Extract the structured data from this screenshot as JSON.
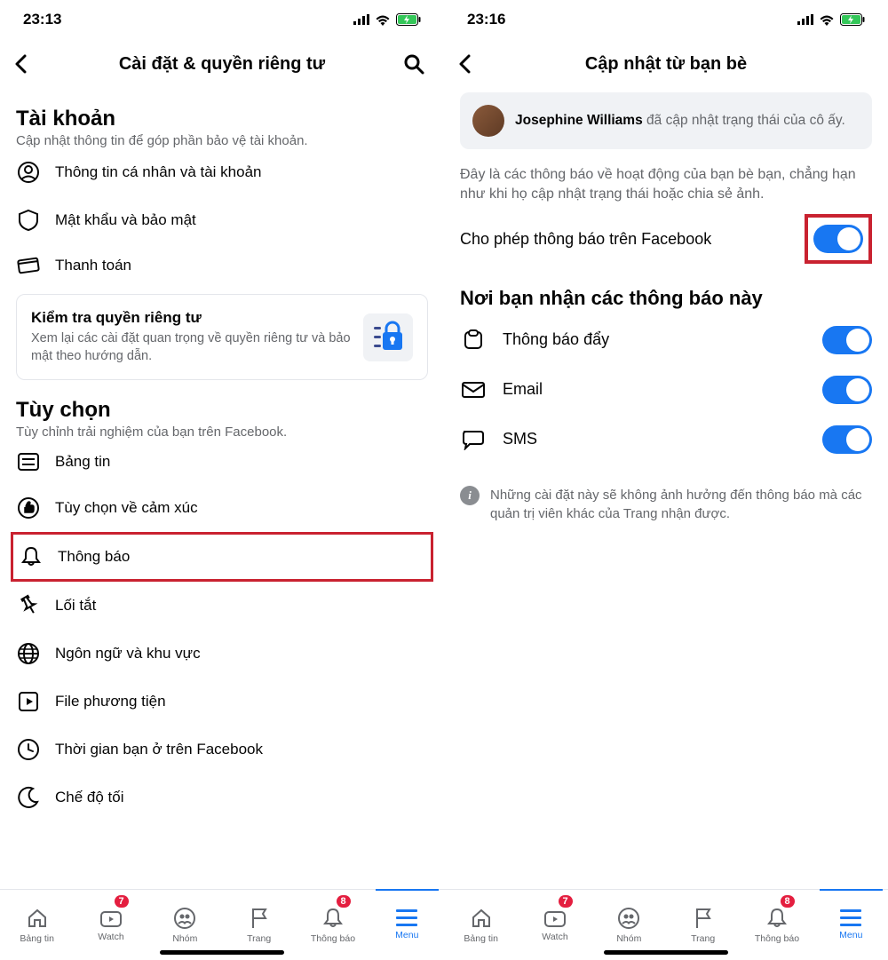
{
  "leftScreen": {
    "statusTime": "23:13",
    "header": {
      "title": "Cài đặt & quyền riêng tư"
    },
    "account": {
      "title": "Tài khoản",
      "subtitle": "Cập nhật thông tin để góp phần bảo vệ tài khoản.",
      "items": [
        "Thông tin cá nhân và tài khoản",
        "Mật khẩu và bảo mật",
        "Thanh toán"
      ],
      "privacyCard": {
        "title": "Kiểm tra quyền riêng tư",
        "desc": "Xem lại các cài đặt quan trọng về quyền riêng tư và bảo mật theo hướng dẫn."
      }
    },
    "options": {
      "title": "Tùy chọn",
      "subtitle": "Tùy chỉnh trải nghiệm của bạn trên Facebook.",
      "items": [
        "Bảng tin",
        "Tùy chọn về cảm xúc",
        "Thông báo",
        "Lối tắt",
        "Ngôn ngữ và khu vực",
        "File phương tiện",
        "Thời gian bạn ở trên Facebook",
        "Chế độ tối"
      ]
    }
  },
  "rightScreen": {
    "statusTime": "23:16",
    "header": {
      "title": "Cập nhật từ bạn bè"
    },
    "exampleName": "Josephine Williams",
    "exampleSuffix": " đã cập nhật trạng thái của cô ấy.",
    "description": "Đây là các thông báo về hoạt động của bạn bè bạn, chẳng hạn như khi họ cập nhật trạng thái hoặc chia sẻ ảnh.",
    "allowLabel": "Cho phép thông báo trên Facebook",
    "receiveHeading": "Nơi bạn nhận các thông báo này",
    "channels": [
      {
        "label": "Thông báo đẩy"
      },
      {
        "label": "Email"
      },
      {
        "label": "SMS"
      }
    ],
    "footerNote": "Những cài đặt này sẽ không ảnh hưởng đến thông báo mà các quản trị viên khác của Trang nhận được."
  },
  "tabBar": {
    "items": [
      {
        "label": "Bảng tin",
        "badge": ""
      },
      {
        "label": "Watch",
        "badge": "7"
      },
      {
        "label": "Nhóm",
        "badge": ""
      },
      {
        "label": "Trang",
        "badge": ""
      },
      {
        "label": "Thông báo",
        "badge": "8"
      },
      {
        "label": "Menu",
        "badge": ""
      }
    ]
  }
}
